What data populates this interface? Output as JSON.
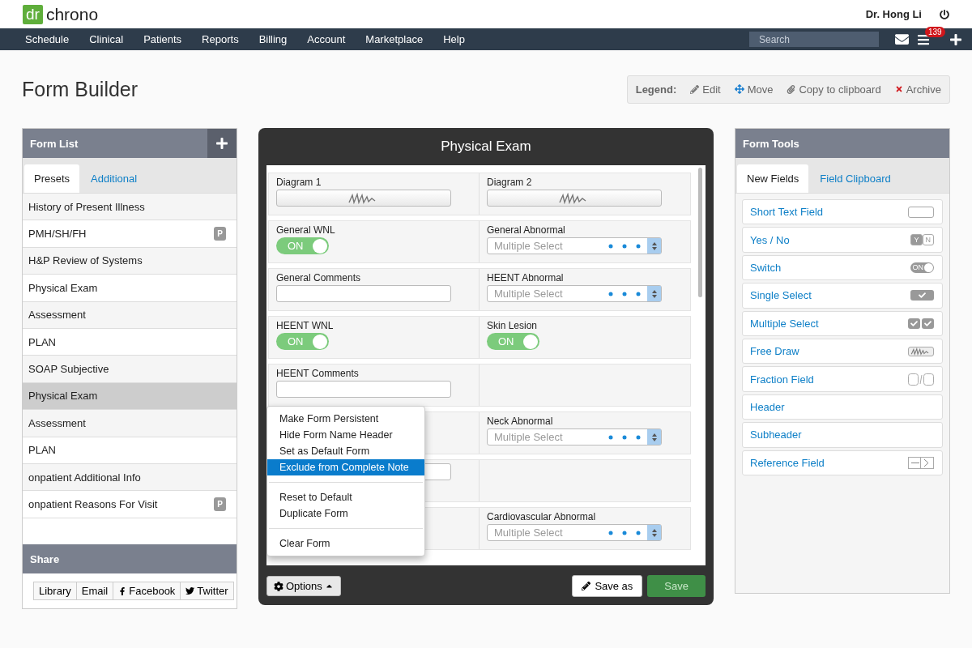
{
  "header": {
    "logo_badge": "dr",
    "logo_text": "chrono",
    "user": "Dr. Hong Li"
  },
  "nav": {
    "items": [
      "Schedule",
      "Clinical",
      "Patients",
      "Reports",
      "Billing",
      "Account",
      "Marketplace",
      "Help"
    ],
    "search_placeholder": "Search",
    "notification_count": "139"
  },
  "page_title": "Form Builder",
  "legend": {
    "label": "Legend:",
    "items": [
      {
        "kind": "edit",
        "label": "Edit"
      },
      {
        "kind": "move",
        "label": "Move"
      },
      {
        "kind": "copy",
        "label": "Copy to clipboard"
      },
      {
        "kind": "archive",
        "label": "Archive"
      }
    ]
  },
  "form_list": {
    "title": "Form List",
    "tabs": [
      {
        "label": "Presets",
        "selected": true
      },
      {
        "label": "Additional",
        "selected": false
      }
    ],
    "items": [
      {
        "label": "History of Present Illness",
        "selected": false
      },
      {
        "label": "PMH/SH/FH",
        "badge": "P",
        "selected": false
      },
      {
        "label": "H&P Review of Systems",
        "selected": false
      },
      {
        "label": "Physical Exam",
        "selected": false
      },
      {
        "label": "Assessment",
        "selected": false
      },
      {
        "label": "PLAN",
        "selected": false
      },
      {
        "label": "SOAP Subjective",
        "selected": false
      },
      {
        "label": "Physical Exam",
        "selected": true
      },
      {
        "label": "Assessment",
        "selected": false
      },
      {
        "label": "PLAN",
        "selected": false
      },
      {
        "label": "onpatient Additional Info",
        "selected": false
      },
      {
        "label": "onpatient Reasons For Visit",
        "badge": "P",
        "selected": false
      }
    ]
  },
  "share": {
    "title": "Share",
    "buttons": [
      {
        "kind": "plain",
        "label": "Library"
      },
      {
        "kind": "plain",
        "label": "Email"
      },
      {
        "kind": "facebook",
        "label": "Facebook"
      },
      {
        "kind": "twitter",
        "label": "Twitter"
      }
    ]
  },
  "form": {
    "title": "Physical Exam",
    "rows": [
      [
        {
          "kind": "draw",
          "label": "Diagram 1"
        },
        {
          "kind": "draw",
          "label": "Diagram 2"
        }
      ],
      [
        {
          "kind": "switch",
          "label": "General WNL",
          "text": "ON",
          "on": true
        },
        {
          "kind": "multi",
          "label": "General Abnormal",
          "placeholder": "Multiple Select"
        }
      ],
      [
        {
          "kind": "text",
          "label": "General Comments"
        },
        {
          "kind": "multi",
          "label": "HEENT Abnormal",
          "placeholder": "Multiple Select"
        }
      ],
      [
        {
          "kind": "switch",
          "label": "HEENT WNL",
          "text": "ON",
          "on": true
        },
        {
          "kind": "switch",
          "label": "Skin Lesion",
          "text": "ON",
          "on": true
        }
      ],
      [
        {
          "kind": "text",
          "label": "HEENT Comments"
        },
        {
          "kind": "empty"
        }
      ],
      [
        {
          "kind": "empty"
        },
        {
          "kind": "multi",
          "label": "Neck Abnormal",
          "placeholder": "Multiple Select"
        }
      ],
      [
        {
          "kind": "text"
        },
        {
          "kind": "empty"
        }
      ],
      [
        {
          "kind": "empty"
        },
        {
          "kind": "multi",
          "label": "Cardiovascular Abnormal",
          "placeholder": "Multiple Select"
        }
      ]
    ],
    "menu": [
      [
        {
          "label": "Make Form Persistent",
          "selected": false
        },
        {
          "label": "Hide Form Name Header",
          "selected": false
        },
        {
          "label": "Set as Default Form",
          "selected": false
        },
        {
          "label": "Exclude from Complete Note",
          "selected": true
        }
      ],
      [
        {
          "label": "Reset to Default",
          "selected": false
        },
        {
          "label": "Duplicate Form",
          "selected": false
        }
      ],
      [
        {
          "label": "Clear Form",
          "selected": false
        }
      ]
    ],
    "options_button": "Options",
    "save_as_button": "Save as",
    "save_button": "Save"
  },
  "form_tools": {
    "title": "Form Tools",
    "tabs": [
      {
        "label": "New Fields",
        "selected": true
      },
      {
        "label": "Field Clipboard",
        "selected": false
      }
    ],
    "items": [
      {
        "kind": "short_text",
        "label": "Short Text Field"
      },
      {
        "kind": "yes_no",
        "label": "Yes / No",
        "icon_text": [
          "Y",
          "N"
        ]
      },
      {
        "kind": "switch",
        "label": "Switch",
        "icon_text": [
          "ON"
        ]
      },
      {
        "kind": "single_select",
        "label": "Single Select"
      },
      {
        "kind": "multi_select",
        "label": "Multiple Select"
      },
      {
        "kind": "free_draw",
        "label": "Free Draw"
      },
      {
        "kind": "fraction",
        "label": "Fraction Field"
      },
      {
        "kind": "none",
        "label": "Header"
      },
      {
        "kind": "none",
        "label": "Subheader"
      },
      {
        "kind": "reference",
        "label": "Reference Field"
      }
    ]
  }
}
